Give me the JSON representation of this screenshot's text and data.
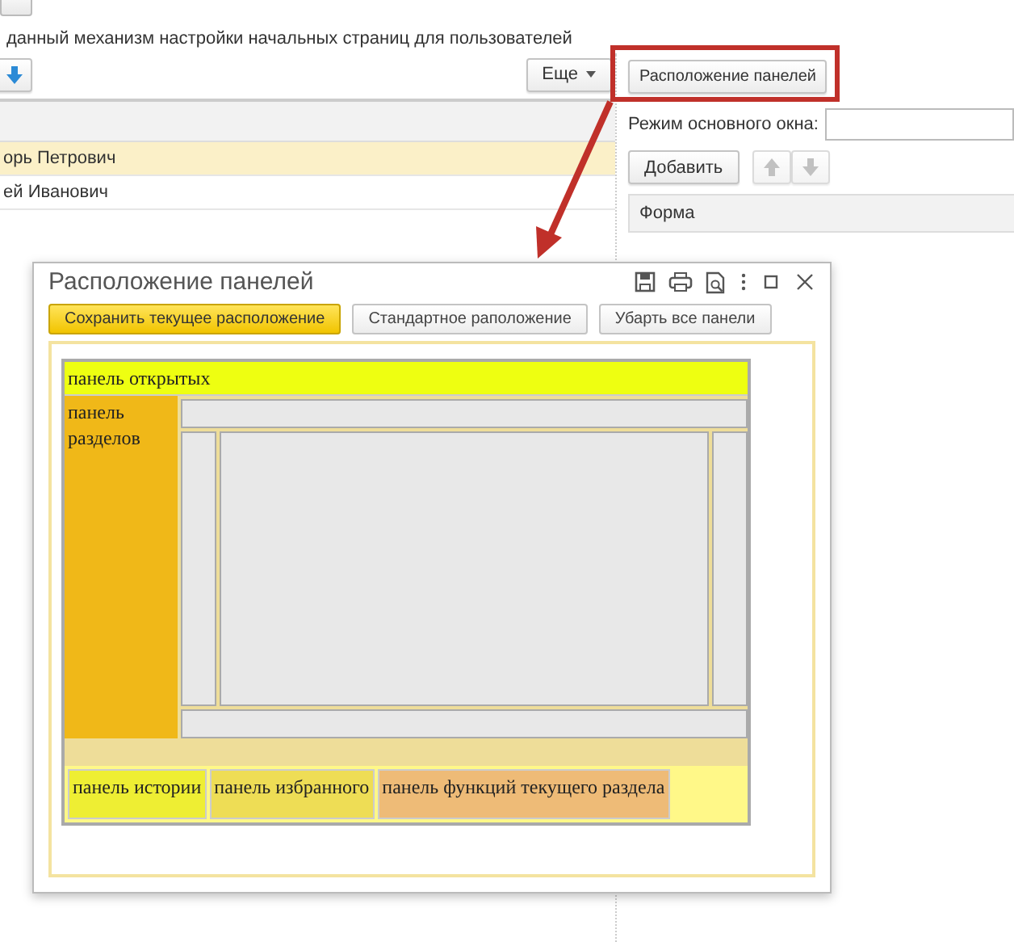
{
  "background": {
    "intro_text": "данный механизм настройки начальных страниц для пользователей",
    "more_button": "Еще",
    "users": [
      {
        "name": "орь Петрович",
        "selected": true
      },
      {
        "name": "ей Иванович",
        "selected": false
      }
    ],
    "panel_layout_button": "Расположение панелей",
    "main_window_mode_label": "Режим основного окна:",
    "add_button": "Добавить",
    "form_column": "Форма"
  },
  "dialog": {
    "title": "Расположение панелей",
    "buttons": [
      {
        "label": "Сохранить текущее расположение",
        "default": true
      },
      {
        "label": "Стандартное раположение",
        "default": false
      },
      {
        "label": "Убарть все панели",
        "default": false
      }
    ],
    "layout": {
      "top_panel": "панель открытых",
      "left_panel": "панель разделов",
      "bottom_panels": [
        {
          "label": "панель истории",
          "color": "#eeee33"
        },
        {
          "label": "панель избранного",
          "color": "#eedd55"
        },
        {
          "label": "панель функций текущего раздела",
          "color": "#eebb77"
        }
      ]
    }
  }
}
